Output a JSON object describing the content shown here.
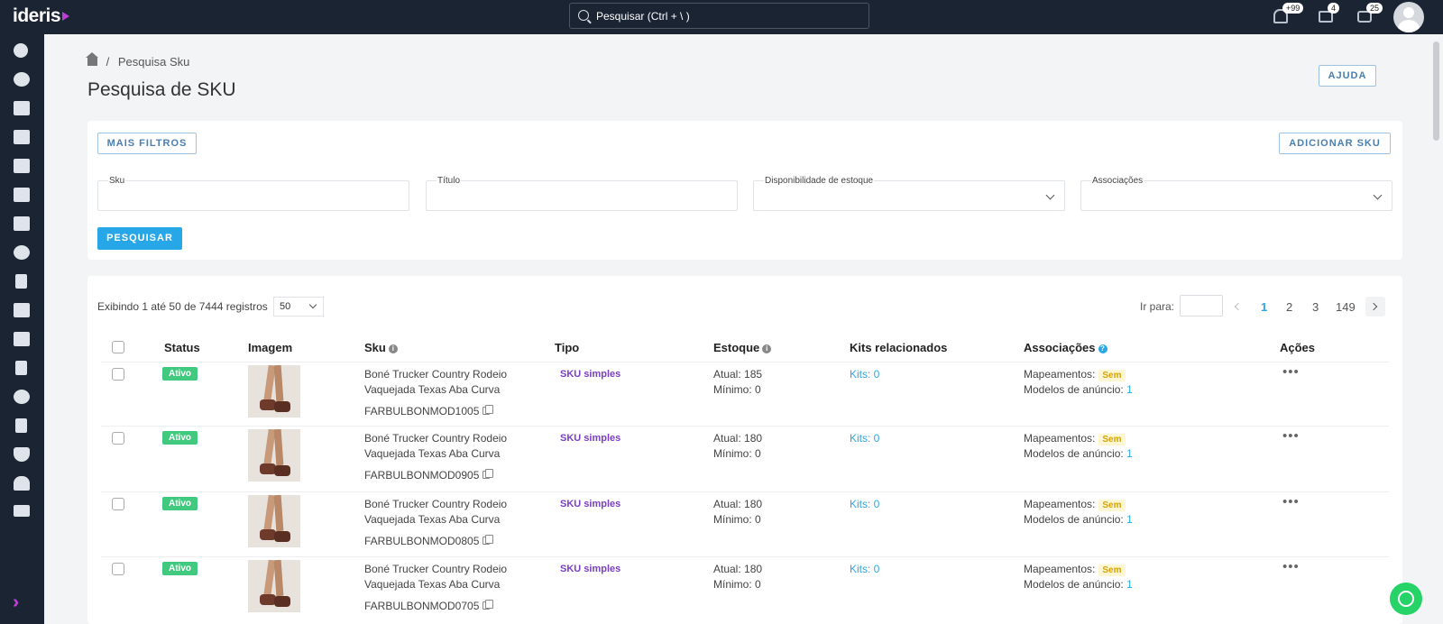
{
  "app": {
    "logo": "ideris"
  },
  "search": {
    "placeholder": "Pesquisar (Ctrl + \\ )"
  },
  "notifications": {
    "bell_count": "+99",
    "mail_count": "4",
    "chat_count": "25"
  },
  "breadcrumb": {
    "current": "Pesquisa Sku"
  },
  "page": {
    "title": "Pesquisa de SKU",
    "help_button": "AJUDA"
  },
  "filters": {
    "more_filters_button": "MAIS FILTROS",
    "add_sku_button": "ADICIONAR SKU",
    "sku_label": "Sku",
    "title_label": "Título",
    "stock_label": "Disponibilidade de estoque",
    "associations_label": "Associações",
    "search_button": "PESQUISAR"
  },
  "results": {
    "summary": "Exibindo 1 até 50 de 7444 registros",
    "page_size": "50",
    "goto_label": "Ir para:",
    "pages": [
      "1",
      "2",
      "3",
      "149"
    ],
    "active_page": "1"
  },
  "table": {
    "headers": {
      "status": "Status",
      "image": "Imagem",
      "sku": "Sku",
      "type": "Tipo",
      "stock": "Estoque",
      "kits": "Kits relacionados",
      "associations": "Associações",
      "actions": "Ações"
    },
    "rows": [
      {
        "status": "Ativo",
        "title_line1": "Boné Trucker Country Rodeio",
        "title_line2": "Vaquejada Texas Aba Curva",
        "code": "FARBULBONMOD1005",
        "type": "SKU simples",
        "stock_current": "Atual: 185",
        "stock_min": "Mínimo: 0",
        "kits": "Kits: 0",
        "map_label": "Mapeamentos:",
        "map_value": "Sem",
        "models_label": "Modelos de anúncio:",
        "models_value": "1"
      },
      {
        "status": "Ativo",
        "title_line1": "Boné Trucker Country Rodeio",
        "title_line2": "Vaquejada Texas Aba Curva",
        "code": "FARBULBONMOD0905",
        "type": "SKU simples",
        "stock_current": "Atual: 180",
        "stock_min": "Mínimo: 0",
        "kits": "Kits: 0",
        "map_label": "Mapeamentos:",
        "map_value": "Sem",
        "models_label": "Modelos de anúncio:",
        "models_value": "1"
      },
      {
        "status": "Ativo",
        "title_line1": "Boné Trucker Country Rodeio",
        "title_line2": "Vaquejada Texas Aba Curva",
        "code": "FARBULBONMOD0805",
        "type": "SKU simples",
        "stock_current": "Atual: 180",
        "stock_min": "Mínimo: 0",
        "kits": "Kits: 0",
        "map_label": "Mapeamentos:",
        "map_value": "Sem",
        "models_label": "Modelos de anúncio:",
        "models_value": "1"
      },
      {
        "status": "Ativo",
        "title_line1": "Boné Trucker Country Rodeio",
        "title_line2": "Vaquejada Texas Aba Curva",
        "code": "FARBULBONMOD0705",
        "type": "SKU simples",
        "stock_current": "Atual: 180",
        "stock_min": "Mínimo: 0",
        "kits": "Kits: 0",
        "map_label": "Mapeamentos:",
        "map_value": "Sem",
        "models_label": "Modelos de anúncio:",
        "models_value": "1"
      }
    ]
  },
  "colors": {
    "topbar": "#1b2433",
    "accent": "#27a7e8",
    "active_badge": "#42c980",
    "brand": "#c13bd9"
  },
  "icons": {
    "sidebar": [
      "share-icon",
      "settings-icon",
      "store-icon",
      "warehouse-icon",
      "archive-icon",
      "megaphone-icon",
      "cart-icon",
      "chat-icon",
      "invoice-icon",
      "chart-icon",
      "truck-icon",
      "money-icon",
      "search-zoom-icon",
      "calculator-icon",
      "shield-icon",
      "users-icon",
      "ticket-icon"
    ]
  }
}
